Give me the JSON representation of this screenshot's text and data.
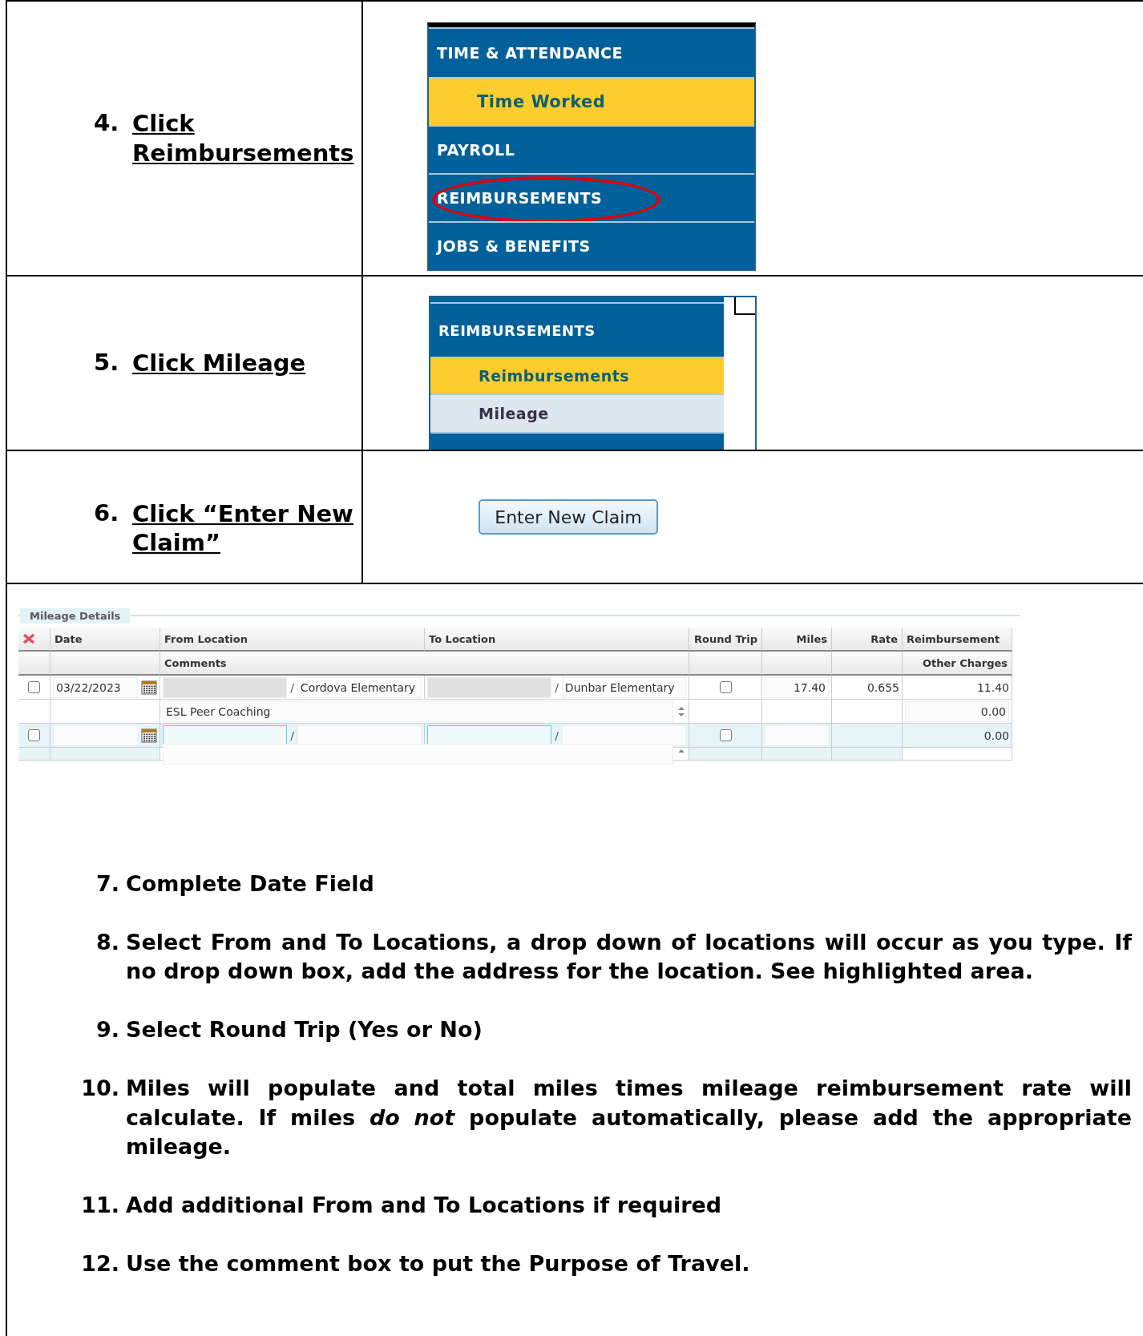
{
  "steps": [
    {
      "number": "4.",
      "text": "Click Reimbursements",
      "figure": {
        "kind": "menu",
        "items": [
          {
            "label": "TIME & ATTENDANCE",
            "kind": "heading",
            "selected": false,
            "circled": false
          },
          {
            "label": "Time Worked",
            "kind": "subitem",
            "selected": true,
            "circled": false
          },
          {
            "label": "PAYROLL",
            "kind": "heading",
            "selected": false,
            "circled": false
          },
          {
            "label": "REIMBURSEMENTS",
            "kind": "heading",
            "selected": false,
            "circled": true
          },
          {
            "label": "JOBS & BENEFITS",
            "kind": "heading",
            "selected": false,
            "circled": false
          }
        ]
      }
    },
    {
      "number": "5.",
      "text": "Click Mileage",
      "figure": {
        "kind": "submenu",
        "items": [
          {
            "label": "REIMBURSEMENTS",
            "kind": "heading",
            "selected": false
          },
          {
            "label": "Reimbursements",
            "kind": "subitem",
            "selected": true
          },
          {
            "label": "Mileage",
            "kind": "subitem",
            "selected": false
          }
        ]
      }
    },
    {
      "number": "6.",
      "text": "Click “Enter New Claim”",
      "figure": {
        "kind": "button",
        "label": "Enter New Claim"
      }
    }
  ],
  "mileage": {
    "legend": "Mileage Details",
    "columns": [
      "Date",
      "From Location",
      "To Location",
      "Round Trip",
      "Miles",
      "Rate",
      "Reimbursement"
    ],
    "subcolumns": [
      "Comments",
      "Other Charges"
    ],
    "entries": [
      {
        "new": false,
        "checked": false,
        "date": "03/22/2023",
        "from_separator": "/",
        "from": "Cordova Elementary",
        "to_separator": "/",
        "to": "Dunbar Elementary",
        "round_trip": false,
        "miles": "17.40",
        "rate": "0.655",
        "reimbursement": "11.40",
        "comment": "ESL Peer Coaching",
        "other_charges": "0.00"
      },
      {
        "new": true,
        "checked": false,
        "from_separator": "/",
        "to_separator": "/",
        "round_trip": false,
        "reimbursement": "0.00"
      }
    ]
  },
  "instructions": [
    {
      "number": "7.",
      "text": "Complete Date Field"
    },
    {
      "number": "8.",
      "text": "Select From and To Locations, a drop down of locations will occur as you type. If no drop down box, add the address for the location. See highlighted area."
    },
    {
      "number": "9.",
      "text": "Select Round Trip (Yes or No)"
    },
    {
      "number": "10.",
      "text": "Miles will populate and total miles times mileage reimbursement rate will calculate.  If miles *do not* populate automatically, please add the appropriate mileage."
    },
    {
      "number": "11.",
      "text": "Add additional From and To Locations if required"
    },
    {
      "number": "12.",
      "text": "Use the comment box to put the Purpose of Travel."
    }
  ]
}
